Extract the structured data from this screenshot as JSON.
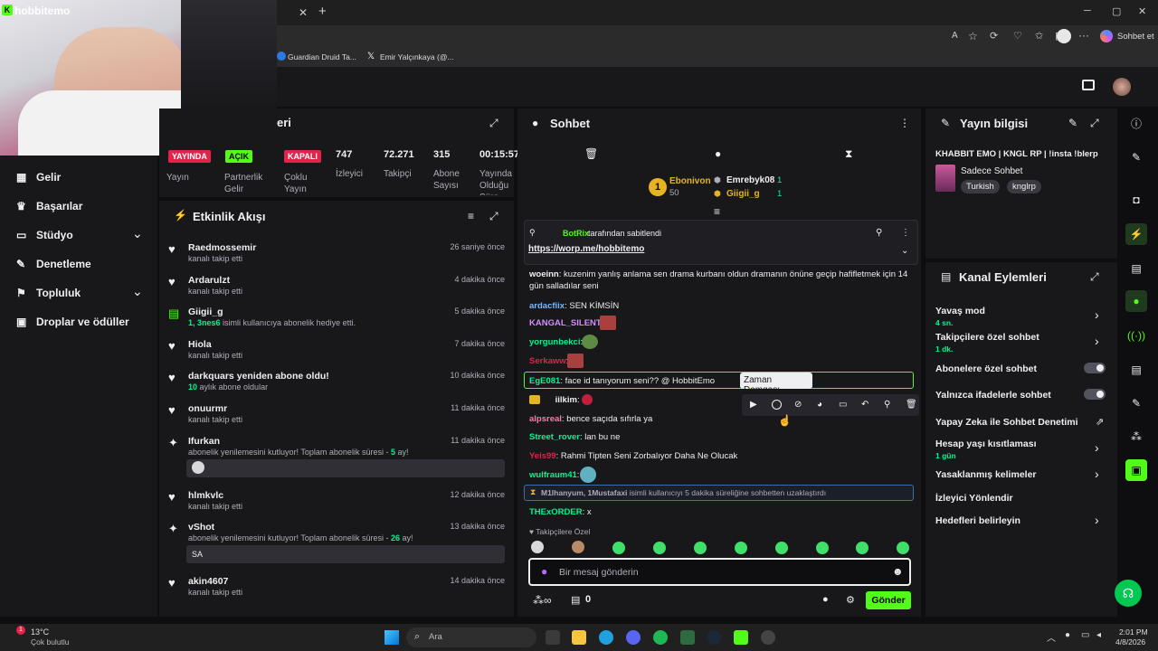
{
  "browser": {
    "tab_close": "✕",
    "tab_new": "+",
    "sohbet_et": "Sohbet et",
    "bookmarks": [
      "Guardian Druid Ta...",
      "Emir Yalçınkaya (@..."
    ],
    "win_min": "─",
    "win_max": "▢",
    "win_close": "✕"
  },
  "webcam_overlay": {
    "channel": "hobbitemo"
  },
  "sidenav": {
    "items": [
      {
        "label": "Gelir"
      },
      {
        "label": "Başarılar"
      },
      {
        "label": "Stüdyo",
        "chevron": "⌄"
      },
      {
        "label": "Denetleme"
      },
      {
        "label": "Topluluk",
        "chevron": "⌄"
      },
      {
        "label": "Droplar ve ödüller"
      }
    ]
  },
  "stream_summary": {
    "title_fragment": "eri",
    "stats": [
      {
        "badge": "YAYINDA",
        "label": "Yayın"
      },
      {
        "badge": "AÇIK",
        "label": "Partnerlik Gelir"
      },
      {
        "badge": "KAPALI",
        "label": "Çoklu Yayın"
      },
      {
        "value": "747",
        "label": "İzleyici"
      },
      {
        "value": "72.271",
        "label": "Takipçi"
      },
      {
        "value": "315",
        "label": "Abone Sayısı"
      },
      {
        "value": "00:15:57",
        "label": "Yayında Olduğu Süre"
      }
    ]
  },
  "activity": {
    "title": "Etkinlik Akışı",
    "events": [
      {
        "name": "Raedmossemir",
        "sub": "kanalı takip etti",
        "time": "26 saniye önce"
      },
      {
        "name": "Ardarulzt",
        "sub": "kanalı takip etti",
        "time": "4 dakika önce"
      },
      {
        "name": "Giigii_g",
        "sub_hl": "1, 3nes6",
        "sub": " isimli kullanıcıya abonelik hediye etti.",
        "time": "5 dakika önce"
      },
      {
        "name": "Hiola",
        "sub": "kanalı takip etti",
        "time": "7 dakika önce"
      },
      {
        "name": "darkquars yeniden abone oldu!",
        "sub_hl": "10",
        "sub": " aylık abone oldular",
        "time": "10 dakika önce"
      },
      {
        "name": "onuurmr",
        "sub": "kanalı takip etti",
        "time": "11 dakika önce"
      },
      {
        "name": "Ifurkan",
        "sub": "abonelik yenilemesini kutluyor! Toplam abonelik süresi - ",
        "sub_hl2": "5",
        "sub_end": " ay!",
        "time": "11 dakika önce"
      },
      {
        "name": "hlmkvlc",
        "sub": "kanalı takip etti",
        "time": "12 dakika önce"
      },
      {
        "name": "vShot",
        "sub": "abonelik yenilemesini kutluyor! Toplam abonelik süresi - ",
        "sub_hl2": "26",
        "sub_end": " ay!",
        "msg": "SA",
        "time": "13 dakika önce"
      },
      {
        "name": "akin4607",
        "sub": "kanalı takip etti",
        "time": "14 dakika önce"
      }
    ]
  },
  "chat": {
    "title": "Sohbet",
    "leaderboard": {
      "rank": "1",
      "first": {
        "name": "Ebonivon",
        "points": "50"
      },
      "second": {
        "name": "Emrebyk08",
        "points": "1"
      },
      "third": {
        "name": "Giigii_g",
        "points": "1"
      }
    },
    "pinned": {
      "by": "BotRix",
      "by_suffix": " tarafından sabitlendi",
      "link": "https://worp.me/hobbitemo"
    },
    "messages": [
      {
        "user": "woeinn",
        "color": "#efeff1",
        "text": "kuzenim yanlış anlama sen drama kurbanı oldun dramanın önüne geçip hafifletmek için 14 gün salladılar seni"
      },
      {
        "user": "ardacfiix",
        "color": "#7ab7ff",
        "text": "SEN KİMSİN"
      },
      {
        "user": "KANGAL_SILENT",
        "color": "#d38cff",
        "text": ""
      },
      {
        "user": "yorgunbekci",
        "color": "#00f593",
        "text": ""
      },
      {
        "user": "Serkaww",
        "color": "#e0244a",
        "text": ""
      },
      {
        "user": "EgE081",
        "color": "#00f593",
        "text": "face id tanıyorum seni?? @ HobbitEmo"
      },
      {
        "user": "iilkim",
        "color": "#efeff1",
        "text": ""
      },
      {
        "user": "alpsreal",
        "color": "#ff7aa8",
        "text": "bence saçıda sıfırla ya"
      },
      {
        "user": "Street_rover",
        "color": "#00f593",
        "text": "lan bu ne"
      },
      {
        "user": "Yeis99",
        "color": "#e0244a",
        "text": "Rahmi Tipten Seni Zorbalıyor Daha Ne Olucak"
      },
      {
        "user": "wulfraum41",
        "color": "#00f593",
        "text": ""
      },
      {
        "user": "THExORDER",
        "color": "#00f593",
        "text": "x"
      }
    ],
    "timeout_notice": {
      "users": "M1lhanyum, 1Mustafaxi",
      "text": " isimli kullanıcıyı 5 dakika süreliğine sohbetten uzaklaştırdı"
    },
    "tooltip": "Zaman Damgası",
    "followers_only": "Takipçilere Özel",
    "input_placeholder": "Bir mesaj gönderin",
    "points": "0",
    "send": "Gönder"
  },
  "stream_info": {
    "title": "Yayın bilgisi",
    "stream_title": "KHABBIT EMO | KNGL RP | !insta !blerp",
    "category": "Sadece Sohbet",
    "tags": [
      "Turkish",
      "knglrp"
    ]
  },
  "channel_actions": {
    "title": "Kanal Eylemleri",
    "items": [
      {
        "label": "Yavaş mod",
        "sub": "4 sn.",
        "control": "chevron"
      },
      {
        "label": "Takipçilere özel sohbet",
        "sub": "1 dk.",
        "control": "chevron"
      },
      {
        "label": "Abonelere özel sohbet",
        "control": "toggle"
      },
      {
        "label": "Yalnızca ifadelerle sohbet",
        "control": "toggle"
      },
      {
        "label": "Yapay Zeka ile Sohbet Denetimi",
        "control": "external"
      },
      {
        "label": "Hesap yaşı kısıtlaması",
        "sub": "1 gün",
        "control": "chevron"
      },
      {
        "label": "Yasaklanmış kelimeler",
        "control": "chevron"
      },
      {
        "label": "İzleyici Yönlendir",
        "control": "none"
      },
      {
        "label": "Hedefleri belirleyin",
        "control": "chevron"
      }
    ]
  },
  "taskbar": {
    "weather_temp": "13°C",
    "weather_desc": "Çok bulutlu",
    "search": "Ara",
    "time": "2:01 PM",
    "date": "4/8/2026"
  },
  "colors": {
    "accent": "#00f593",
    "kick_green": "#53fc18",
    "live_red": "#e0244a",
    "panel": "#18181b",
    "bg": "#0e0e10"
  }
}
